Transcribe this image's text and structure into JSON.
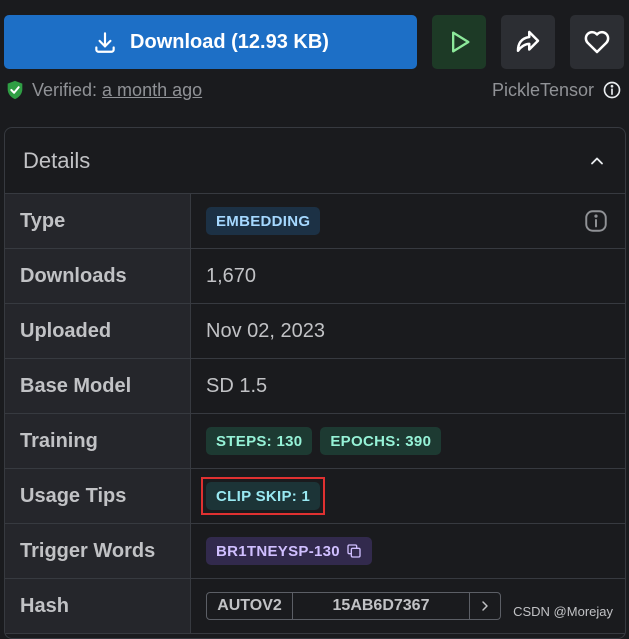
{
  "download": {
    "label": "Download (12.93 KB)"
  },
  "verified": {
    "label": "Verified:",
    "time": "a month ago",
    "format": "PickleTensor"
  },
  "details": {
    "title": "Details",
    "rows": {
      "type": {
        "label": "Type",
        "badge": "EMBEDDING"
      },
      "downloads": {
        "label": "Downloads",
        "value": "1,670"
      },
      "uploaded": {
        "label": "Uploaded",
        "value": "Nov 02, 2023"
      },
      "base_model": {
        "label": "Base Model",
        "value": "SD 1.5"
      },
      "training": {
        "label": "Training",
        "steps": "STEPS: 130",
        "epochs": "EPOCHS: 390"
      },
      "usage_tips": {
        "label": "Usage Tips",
        "clip_skip": "CLIP SKIP: 1"
      },
      "trigger_words": {
        "label": "Trigger Words",
        "word": "BR1TNEYSP-130"
      },
      "hash": {
        "label": "Hash",
        "type": "AUTOV2",
        "value": "15AB6D7367"
      }
    }
  },
  "watermark": "CSDN @Morejay",
  "colors": {
    "download": "#1d6fc6",
    "highlight": "#e03131"
  }
}
